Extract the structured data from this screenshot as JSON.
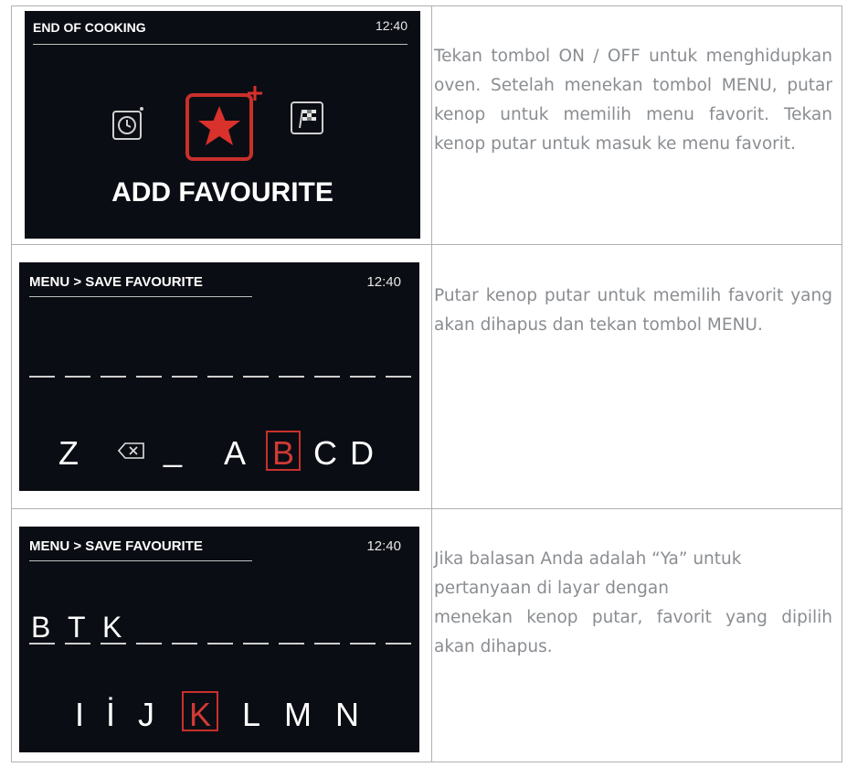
{
  "rows": [
    {
      "screen": {
        "title": "END OF COOKING",
        "time": "12:40",
        "label": "ADD FAVOURITE",
        "icons": [
          "timer-icon",
          "add-favourite-star-icon",
          "finish-flag-icon"
        ]
      },
      "text": "Tekan tombol ON / OFF untuk menghidupkan oven. Setelah menekan tombol MENU, putar kenop untuk memilih menu favorit. Tekan kenop putar untuk masuk ke menu favorit."
    },
    {
      "screen": {
        "title": "MENU > SAVE FAVOURITE",
        "time": "12:40",
        "keys": [
          "Z",
          "⌫",
          "_",
          "A",
          "B",
          "C",
          "D"
        ],
        "selected_key": "B"
      },
      "text": "Putar kenop putar untuk memilih favorit yang akan dihapus dan tekan tombol MENU."
    },
    {
      "screen": {
        "title": "MENU > SAVE FAVOURITE",
        "time": "12:40",
        "entered": [
          "B",
          "T",
          "K"
        ],
        "keys": [
          "I",
          "İ",
          "J",
          "K",
          "L",
          "M",
          "N"
        ],
        "selected_key": "K"
      },
      "text_line1": "Jika balasan Anda adalah “Ya” untuk pertanyaan di layar dengan",
      "text_line2": "menekan kenop putar, favorit yang dipilih akan dihapus."
    }
  ]
}
